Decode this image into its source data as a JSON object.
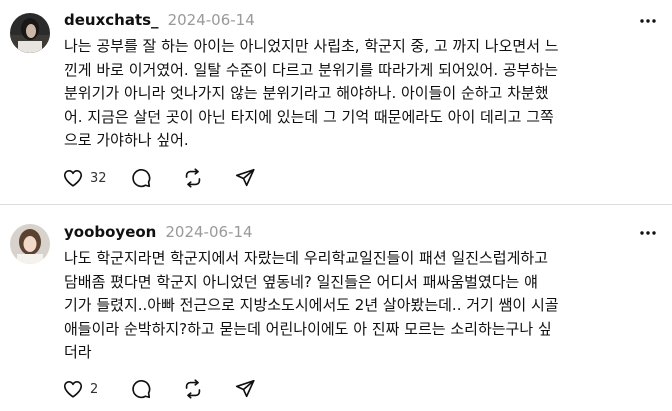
{
  "posts": [
    {
      "username": "deuxchats_",
      "date": "2024-06-14",
      "lines": [
        "나는 공부를 잘 하는 아이는 아니었지만 사립초, 학군지 중, 고 까지 나오면서 느",
        "낀게 바로 이거였어. 일탈 수준이 다르고 분위기를 따라가게 되어있어. 공부하는",
        "분위기가 아니라 엇나가지 않는 분위기라고 해야하나. 아이들이 순하고 차분했",
        "어. 지금은 살던 곳이 아닌 타지에 있는데 그 기억 때문에라도 아이 데리고 그쪽",
        "으로 가야하나 싶어."
      ],
      "like_count": "32"
    },
    {
      "username": "yooboyeon",
      "date": "2024-06-14",
      "lines": [
        "나도 학군지라면 학군지에서 자랐는데 우리학교일진들이 패션 일진스럽게하고",
        "담배좀 폈다면 학군지 아니었던 옆동네? 일진들은 어디서 패싸움벌였다는 얘",
        "기가 들렸지..아빠 전근으로 지방소도시에서도 2년 살아봤는데.. 거기 쌤이 시골",
        "애들이라 순박하지?하고 묻는데 어린나이에도 아 진짜 모르는 소리하는구나 싶",
        "더라"
      ],
      "like_count": "2"
    }
  ],
  "icons": {
    "more": "more-horizontal-icon",
    "like": "heart-icon",
    "comment": "comment-icon",
    "repost": "repost-icon",
    "share": "send-icon"
  }
}
